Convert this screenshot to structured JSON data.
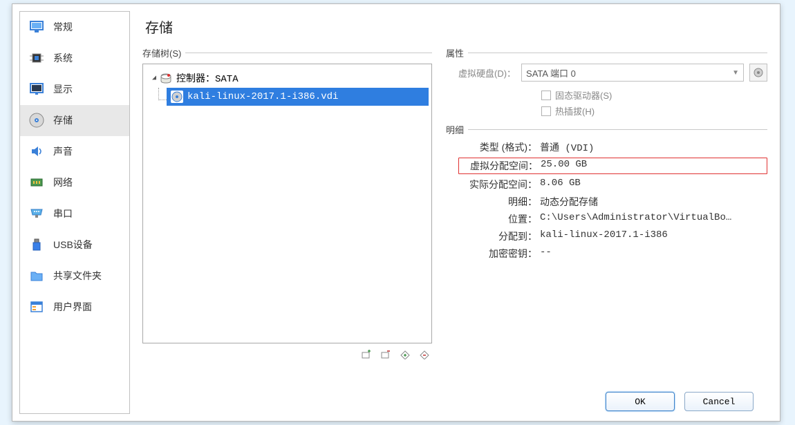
{
  "page_title": "存储",
  "sidebar": {
    "items": [
      {
        "label": "常规",
        "icon": "monitor"
      },
      {
        "label": "系统",
        "icon": "chip"
      },
      {
        "label": "显示",
        "icon": "display"
      },
      {
        "label": "存储",
        "icon": "disk",
        "selected": true
      },
      {
        "label": "声音",
        "icon": "audio"
      },
      {
        "label": "网络",
        "icon": "network"
      },
      {
        "label": "串口",
        "icon": "serial"
      },
      {
        "label": "USB设备",
        "icon": "usb"
      },
      {
        "label": "共享文件夹",
        "icon": "folder"
      },
      {
        "label": "用户界面",
        "icon": "ui"
      }
    ]
  },
  "storage_tree": {
    "group_label": "存储树(S)",
    "controller_label": "控制器：SATA",
    "disk_file": "kali-linux-2017.1-i386.vdi"
  },
  "attributes": {
    "group_label": "属性",
    "hard_disk_label": "虚拟硬盘(D)：",
    "hard_disk_value": "SATA 端口 0",
    "ssd_label": "固态驱动器(S)",
    "hotplug_label": "热插拔(H)"
  },
  "details": {
    "group_label": "明细",
    "rows": [
      {
        "label": "类型 (格式)：",
        "value": "普通  (VDI)"
      },
      {
        "label": "虚拟分配空间：",
        "value": "25.00  GB",
        "highlighted": true
      },
      {
        "label": "实际分配空间：",
        "value": "8.06  GB"
      },
      {
        "label": "明细：",
        "value": "动态分配存储"
      },
      {
        "label": "位置：",
        "value": "C:\\Users\\Administrator\\VirtualBo…"
      },
      {
        "label": "分配到：",
        "value": "kali-linux-2017.1-i386"
      },
      {
        "label": "加密密钥：",
        "value": "--"
      }
    ]
  },
  "buttons": {
    "ok": "OK",
    "cancel": "Cancel"
  }
}
